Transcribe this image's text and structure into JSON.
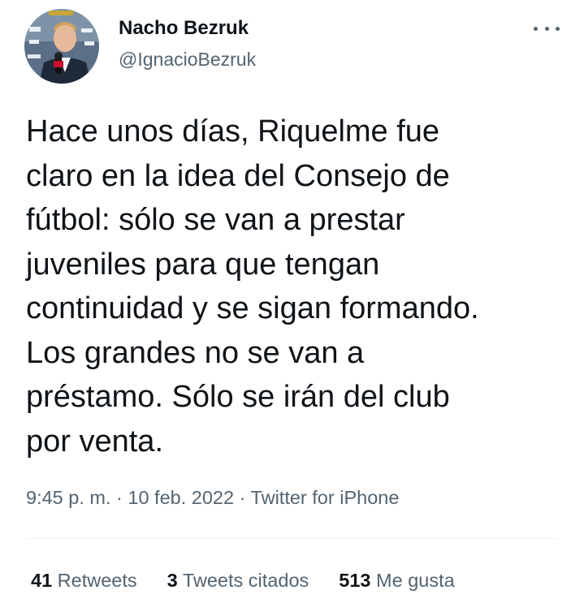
{
  "author": {
    "display_name": "Nacho Bezruk",
    "handle": "@IgnacioBezruk",
    "avatar_icon": "avatar-photo"
  },
  "more_icon": "more-horizontal-icon",
  "tweet": {
    "text_lines": [
      "Hace unos días, Riquelme fue",
      "claro en la idea del Consejo de",
      "fútbol: sólo se van a prestar",
      "juveniles para que tengan",
      "continuidad y se sigan formando.",
      "Los grandes no se van a",
      "préstamo. Sólo se irán del club",
      "por venta."
    ]
  },
  "meta": {
    "time": "9:45 p. m.",
    "separator": "·",
    "date": "10 feb. 2022",
    "source": "Twitter for iPhone"
  },
  "stats": {
    "retweets_count": "41",
    "retweets_label": "Retweets",
    "quotes_count": "3",
    "quotes_label": "Tweets citados",
    "likes_count": "513",
    "likes_label": "Me gusta"
  },
  "colors": {
    "primary_text": "#0f1419",
    "secondary_text": "#536471",
    "divider": "#eff3f4"
  }
}
